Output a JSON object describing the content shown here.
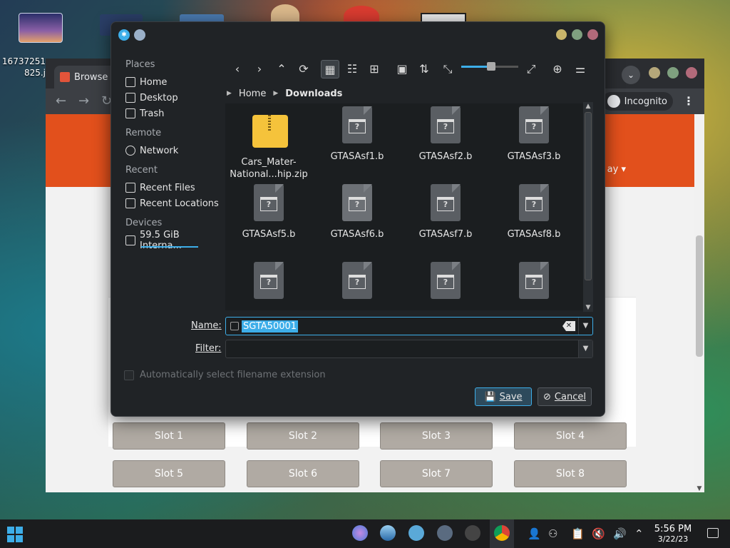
{
  "desktop": {
    "icon_label_line1": "16737251",
    "icon_label_line2": "825.j"
  },
  "browser": {
    "tab_title": "Browse",
    "incognito_label": "Incognito",
    "header_text": "ay ▾",
    "slots": [
      "Slot 1",
      "Slot 2",
      "Slot 3",
      "Slot 4",
      "Slot 5",
      "Slot 6",
      "Slot 7",
      "Slot 8"
    ]
  },
  "dialog": {
    "places": {
      "places_header": "Places",
      "home": "Home",
      "desktop": "Desktop",
      "trash": "Trash",
      "remote_header": "Remote",
      "network": "Network",
      "recent_header": "Recent",
      "recent_files": "Recent Files",
      "recent_locations": "Recent Locations",
      "devices_header": "Devices",
      "device": "59.5 GiB Interna..."
    },
    "breadcrumb": {
      "home": "Home",
      "current": "Downloads"
    },
    "files": [
      {
        "line1": "Cars_Mater-",
        "line2": "National...hip.zip",
        "type": "zip"
      },
      {
        "line1": "GTASAsf1.b",
        "line2": "",
        "type": "doc"
      },
      {
        "line1": "GTASAsf2.b",
        "line2": "",
        "type": "doc"
      },
      {
        "line1": "GTASAsf3.b",
        "line2": "",
        "type": "doc"
      },
      {
        "line1": "GTASAsf5.b",
        "line2": "",
        "type": "doc"
      },
      {
        "line1": "GTASAsf6.b",
        "line2": "",
        "type": "doc"
      },
      {
        "line1": "GTASAsf7.b",
        "line2": "",
        "type": "doc"
      },
      {
        "line1": "GTASAsf8.b",
        "line2": "",
        "type": "doc"
      },
      {
        "line1": "",
        "line2": "",
        "type": "doc"
      },
      {
        "line1": "",
        "line2": "",
        "type": "doc"
      },
      {
        "line1": "",
        "line2": "",
        "type": "doc"
      },
      {
        "line1": "",
        "line2": "",
        "type": "doc"
      }
    ],
    "name_label": "Name:",
    "name_value": "SGTA50001",
    "filter_label": "Filter:",
    "filter_value": "",
    "auto_ext_label": "Automatically select filename extension",
    "save_label": "Save",
    "cancel_label": "Cancel",
    "zoom_level": 0.52
  },
  "taskbar": {
    "time": "5:56 PM",
    "date": "3/22/23"
  },
  "colors": {
    "accent": "#3daee9",
    "dialog_bg": "#202326",
    "orange": "#e2501c",
    "slot_bg": "#b0aaa3"
  }
}
